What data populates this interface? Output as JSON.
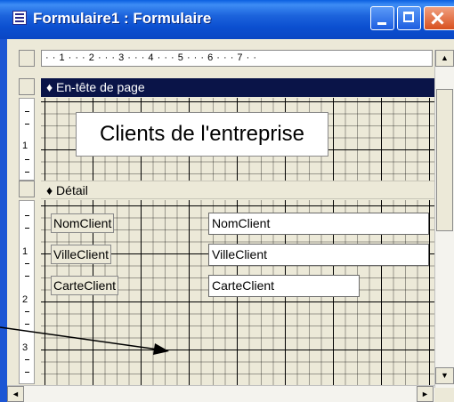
{
  "window": {
    "title": "Formulaire1 : Formulaire"
  },
  "ruler": {
    "marks": " · · 1 · · · 2 · · · 3 · · · 4 · · · 5 · · · 6 · · · 7 · · "
  },
  "vruler_header": [
    "1"
  ],
  "vruler_detail": [
    "1",
    "2",
    "3"
  ],
  "sections": {
    "header": "En-tête de page",
    "detail": "Détail"
  },
  "form": {
    "title_label": "Clients de l'entreprise",
    "fields": [
      {
        "label": "NomClient",
        "value": "NomClient"
      },
      {
        "label": "VilleClient",
        "value": "VilleClient"
      },
      {
        "label": "CarteClient",
        "value": "CarteClient"
      }
    ]
  },
  "scroll": {
    "up": "▲",
    "down": "▼",
    "left": "◄",
    "right": "►"
  },
  "colors": {
    "titlebar": "#0b4fd0",
    "header_bar": "#0a1448",
    "form_bg": "#ece9d8"
  },
  "icons": [
    "form-view-icon",
    "minimize-icon",
    "maximize-icon",
    "close-icon",
    "section-marker-icon"
  ]
}
